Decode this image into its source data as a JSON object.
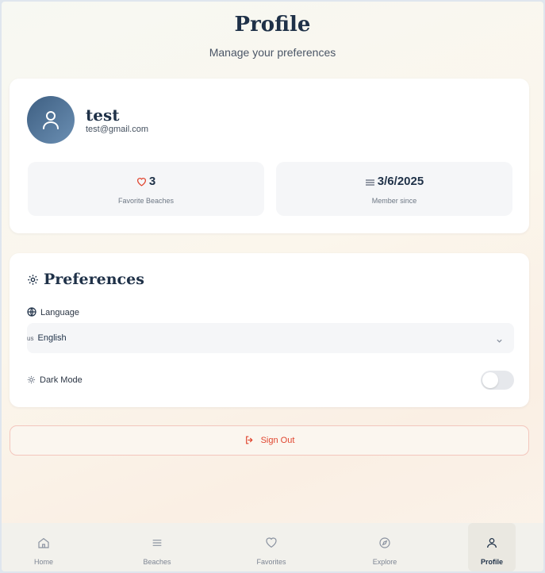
{
  "header": {
    "title": "Profile",
    "subtitle": "Manage your preferences"
  },
  "profile": {
    "username": "test",
    "email": "test@gmail.com",
    "stats": {
      "favorites_value": "3",
      "favorites_label": "Favorite Beaches",
      "member_value": "3/6/2025",
      "member_label": "Member since"
    }
  },
  "preferences": {
    "title": "Preferences",
    "language_label": "Language",
    "language_flag": "us",
    "language_value": "English",
    "dark_mode_label": "Dark Mode",
    "dark_mode_on": false
  },
  "sign_out_label": "Sign Out",
  "nav": {
    "items": [
      {
        "label": "Home",
        "icon": "home-icon"
      },
      {
        "label": "Beaches",
        "icon": "list-icon"
      },
      {
        "label": "Favorites",
        "icon": "heart-icon"
      },
      {
        "label": "Explore",
        "icon": "compass-icon"
      },
      {
        "label": "Profile",
        "icon": "user-icon",
        "active": true
      }
    ]
  },
  "colors": {
    "primary": "#1f3148",
    "accent_red": "#e0452f",
    "avatar": "#4a6b8f"
  }
}
